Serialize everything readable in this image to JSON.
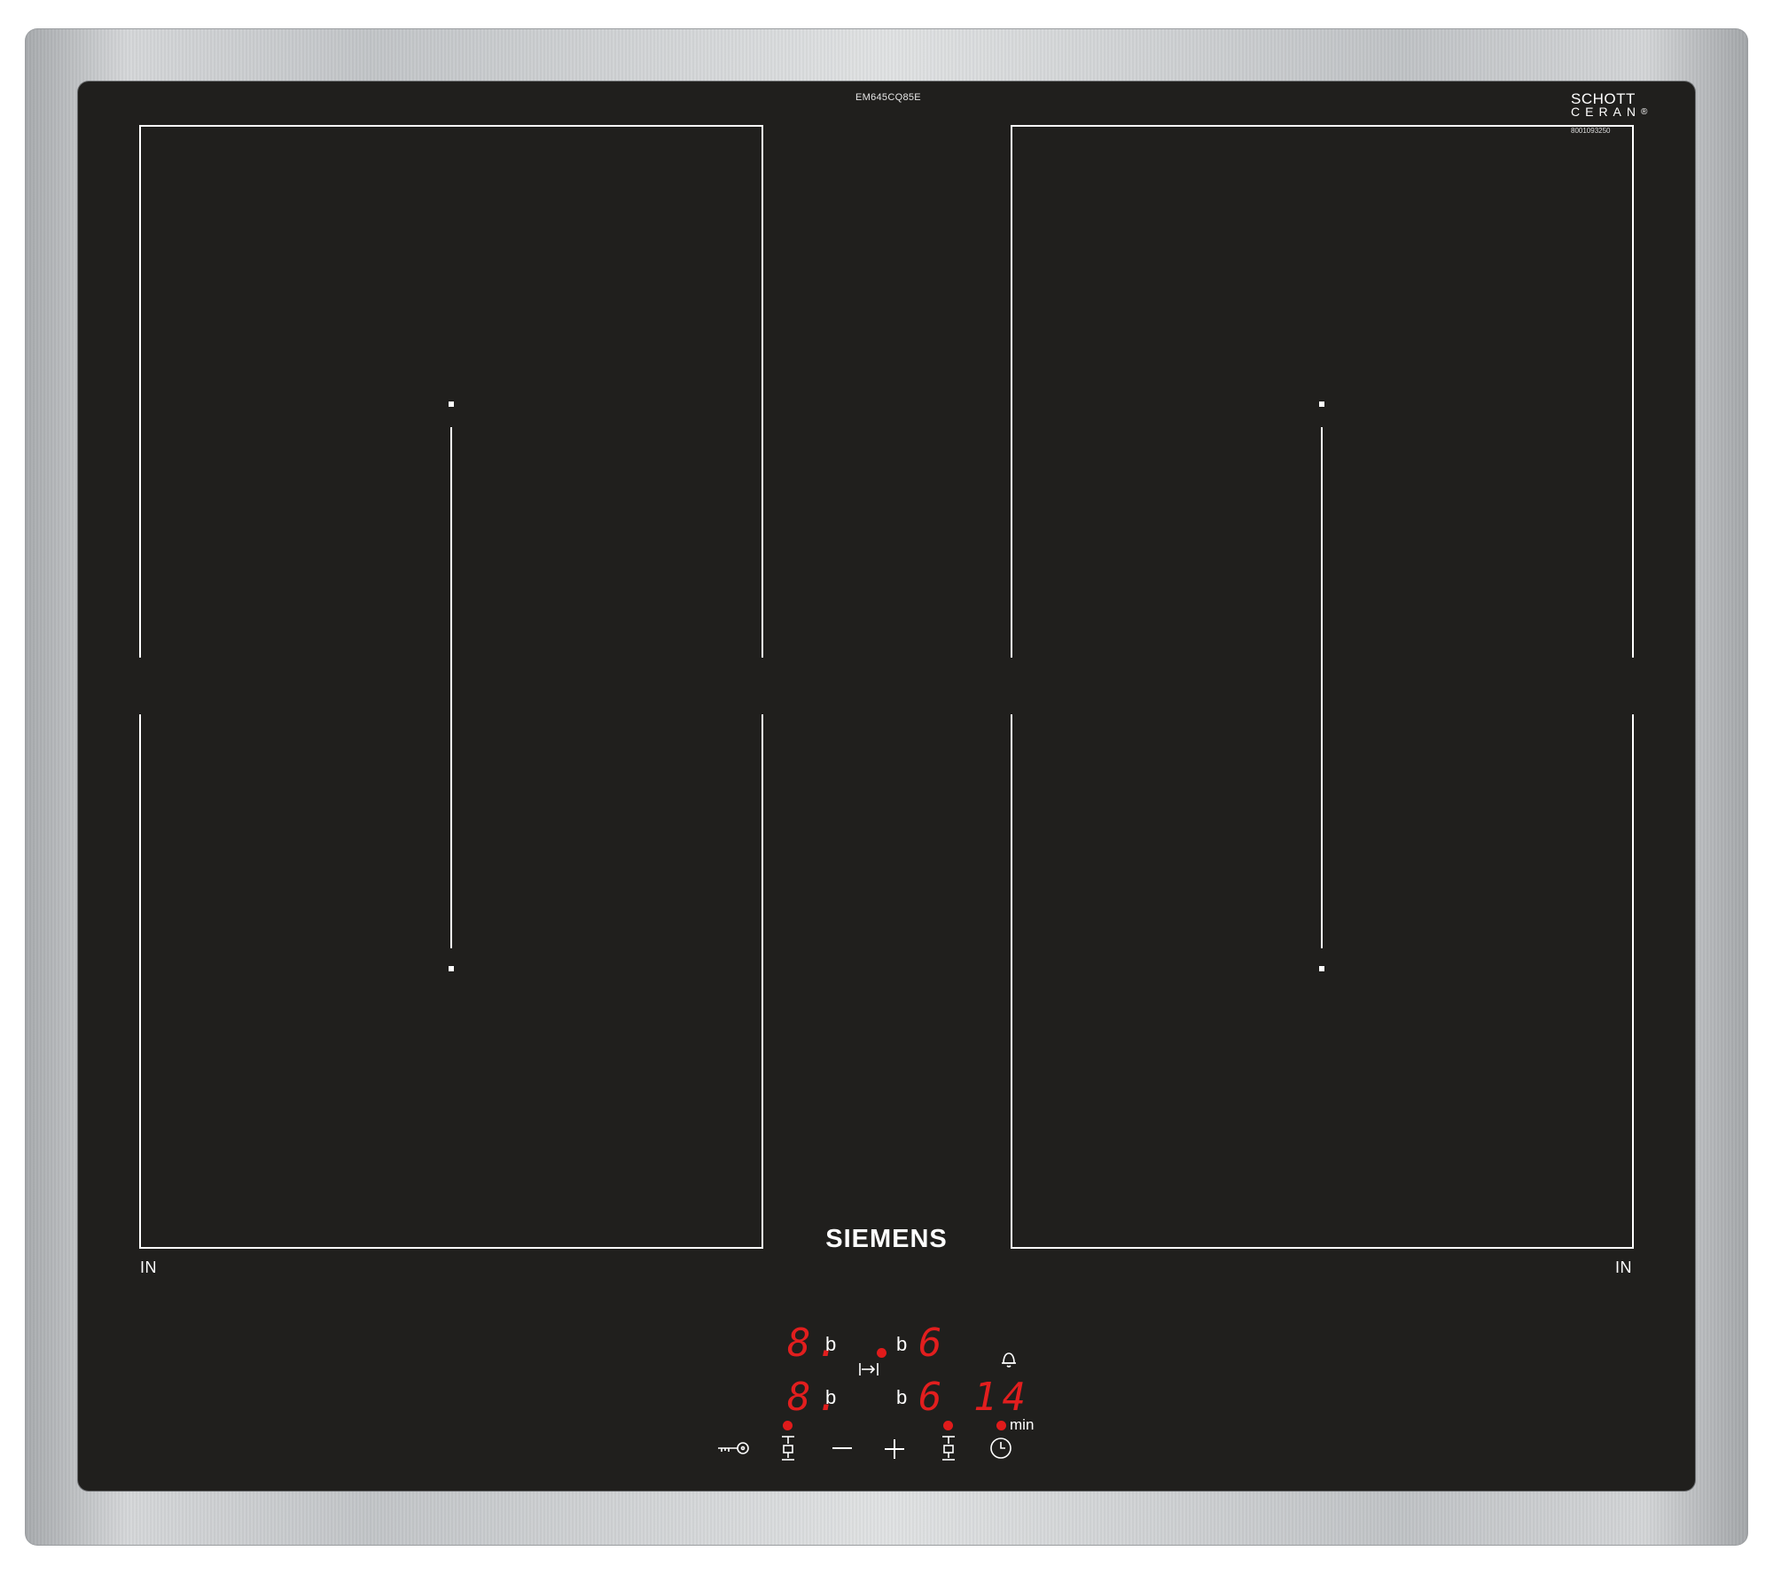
{
  "product": {
    "model_code": "EM645CQ85E",
    "glass_brand_line1": "SCHOTT",
    "glass_brand_line2": "CERAN",
    "glass_brand_registered": "®",
    "serial": "8001093250",
    "brand": "SIEMENS"
  },
  "zones": {
    "left_label": "IN",
    "right_label": "IN"
  },
  "display": {
    "front_left_level": "8.",
    "rear_left_level": "8.",
    "front_right_level": "6",
    "rear_right_level": "6",
    "boost_symbol": "b",
    "timer_value": "14",
    "timer_unit": "min"
  },
  "controls": [
    {
      "name": "childlock-key",
      "icon": "key-icon"
    },
    {
      "name": "zone-select-left",
      "icon": "zone-selector-icon"
    },
    {
      "name": "minus",
      "icon": "minus-icon"
    },
    {
      "name": "plus",
      "icon": "plus-icon"
    },
    {
      "name": "zone-select-right",
      "icon": "zone-selector-icon"
    },
    {
      "name": "timer",
      "icon": "clock-icon"
    }
  ],
  "colors": {
    "glass": "#201f1d",
    "display_red": "#e21e1e",
    "lines": "#ffffff"
  }
}
